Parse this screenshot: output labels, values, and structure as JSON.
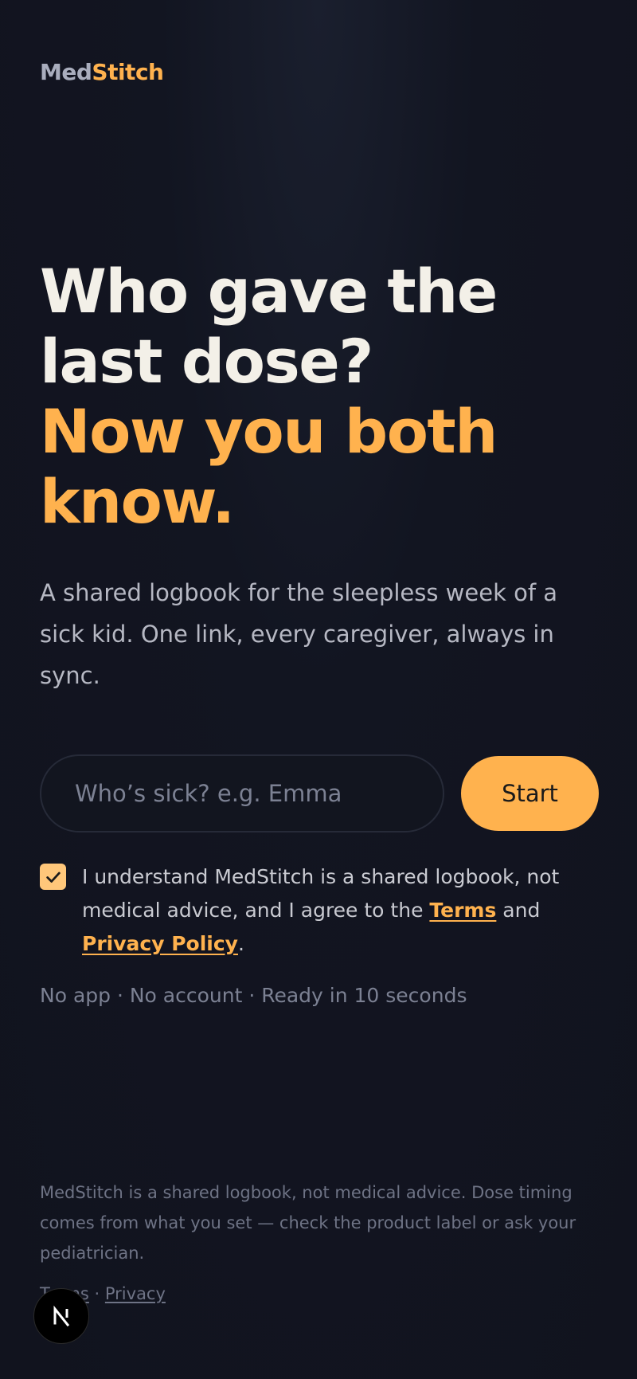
{
  "brand": {
    "part1": "Med",
    "part2": "Stitch",
    "part1_color": "#a9adbd",
    "part2_color": "#ffb24e"
  },
  "hero": {
    "line1": "Who gave the",
    "line2": "last dose?",
    "line3": "Now you both",
    "line4": "know.",
    "accent_color": "#ffb24e"
  },
  "subtitle": "A shared logbook for the sleepless week of a sick kid. One link, every caregiver, always in sync.",
  "form": {
    "name_input": {
      "placeholder": "Who’s sick? e.g. Emma",
      "value": ""
    },
    "start_label": "Start"
  },
  "consent": {
    "checked": true,
    "text_before": "I understand MedStitch is a shared logbook, not medical advice, and I agree to the ",
    "terms_label": "Terms",
    "text_between": " and ",
    "privacy_label": "Privacy Policy",
    "text_after": "."
  },
  "features_line": "No app · No account · Ready in 10 seconds",
  "footer": {
    "disclaimer": "MedStitch is a shared logbook, not medical advice. Dose timing comes from what you set — check the product label or ask your pediatrician.",
    "terms_label": "Terms",
    "separator": " · ",
    "privacy_label": "Privacy"
  },
  "dev_badge": {
    "letter": "N",
    "icon": "nextjs-logo-icon"
  }
}
